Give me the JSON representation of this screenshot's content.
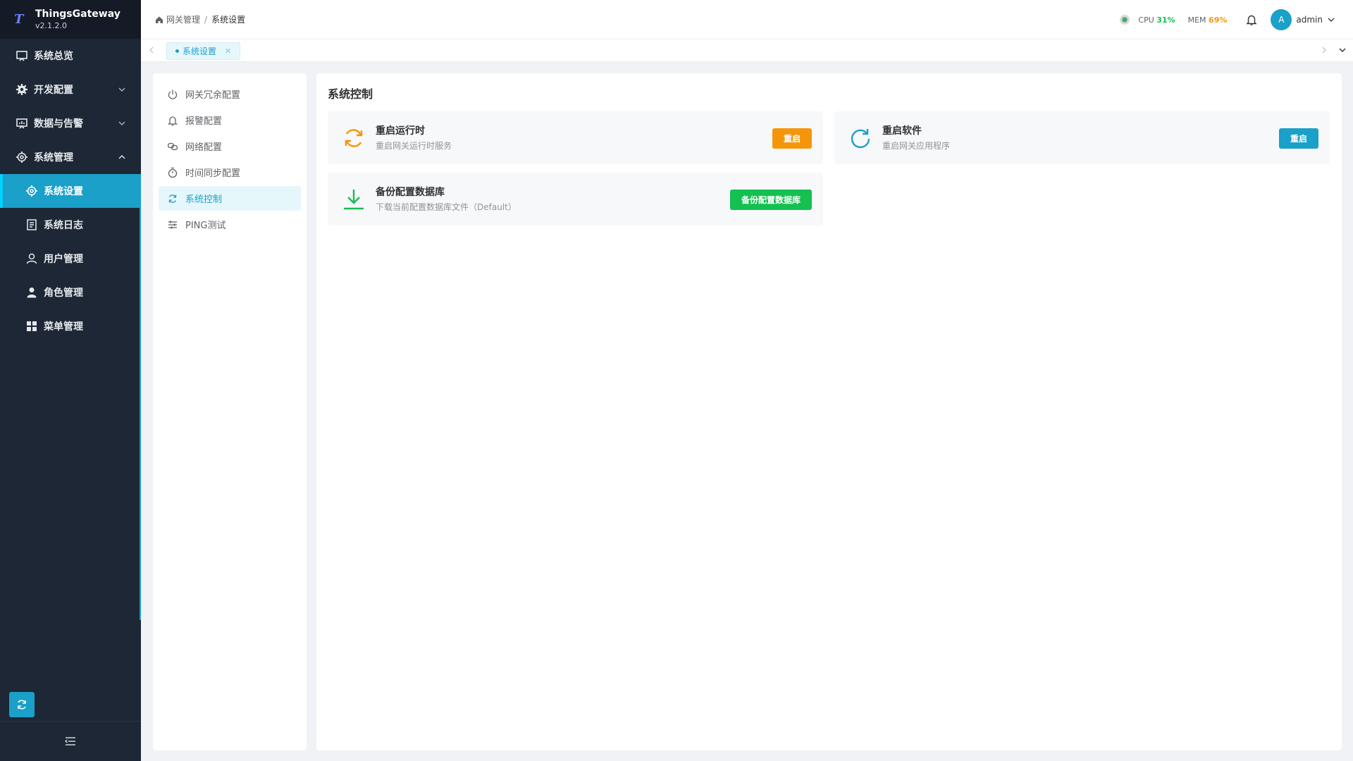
{
  "brand": {
    "name": "ThingsGateway",
    "version": "v2.1.2.0",
    "logo_letter": "T"
  },
  "sidebar": {
    "items": [
      {
        "label": "系统总览",
        "icon": "monitor-icon",
        "level": 0
      },
      {
        "label": "开发配置",
        "icon": "gear-icon",
        "level": 0,
        "expandable": true,
        "expanded": false
      },
      {
        "label": "数据与告警",
        "icon": "monitor-icon",
        "level": 0,
        "expandable": true,
        "expanded": false
      },
      {
        "label": "系统管理",
        "icon": "gear-icon",
        "level": 0,
        "expandable": true,
        "expanded": true
      },
      {
        "label": "系统设置",
        "icon": "gear-icon",
        "level": 1,
        "active": true
      },
      {
        "label": "系统日志",
        "icon": "log-icon",
        "level": 1
      },
      {
        "label": "用户管理",
        "icon": "user-icon",
        "level": 1
      },
      {
        "label": "角色管理",
        "icon": "person-icon",
        "level": 1
      },
      {
        "label": "菜单管理",
        "icon": "grid-icon",
        "level": 1
      }
    ]
  },
  "header": {
    "breadcrumb": [
      "网关管理",
      "系统设置"
    ],
    "cpu_label": "CPU",
    "cpu_value": "31%",
    "mem_label": "MEM",
    "mem_value": "69%",
    "user_initial": "A",
    "user_name": "admin"
  },
  "tabs": [
    {
      "label": "系统设置",
      "active": true
    }
  ],
  "settings_nav": [
    {
      "label": "网关冗余配置",
      "icon": "power-icon"
    },
    {
      "label": "报警配置",
      "icon": "bell-icon"
    },
    {
      "label": "网络配置",
      "icon": "link-icon"
    },
    {
      "label": "时间同步配置",
      "icon": "stopwatch-icon"
    },
    {
      "label": "系统控制",
      "icon": "sync-icon",
      "active": true
    },
    {
      "label": "PING测试",
      "icon": "sliders-icon"
    }
  ],
  "panel": {
    "title": "系统控制",
    "cards": [
      {
        "title": "重启运行时",
        "desc": "重启网关运行时服务",
        "button": "重启",
        "icon": "sync-icon",
        "color": "#f5960a"
      },
      {
        "title": "重启软件",
        "desc": "重启网关应用程序",
        "button": "重启",
        "icon": "refresh-icon",
        "color": "#1aa0c9"
      },
      {
        "title": "备份配置数据库",
        "desc": "下载当前配置数据库文件（Default）",
        "button": "备份配置数据库",
        "icon": "download-icon",
        "color": "#14c050"
      }
    ]
  },
  "colors": {
    "accent": "#1aa0c9",
    "sidebar_bg": "#1d2735",
    "cpu_color": "#14c050",
    "mem_color": "#f5960a"
  }
}
